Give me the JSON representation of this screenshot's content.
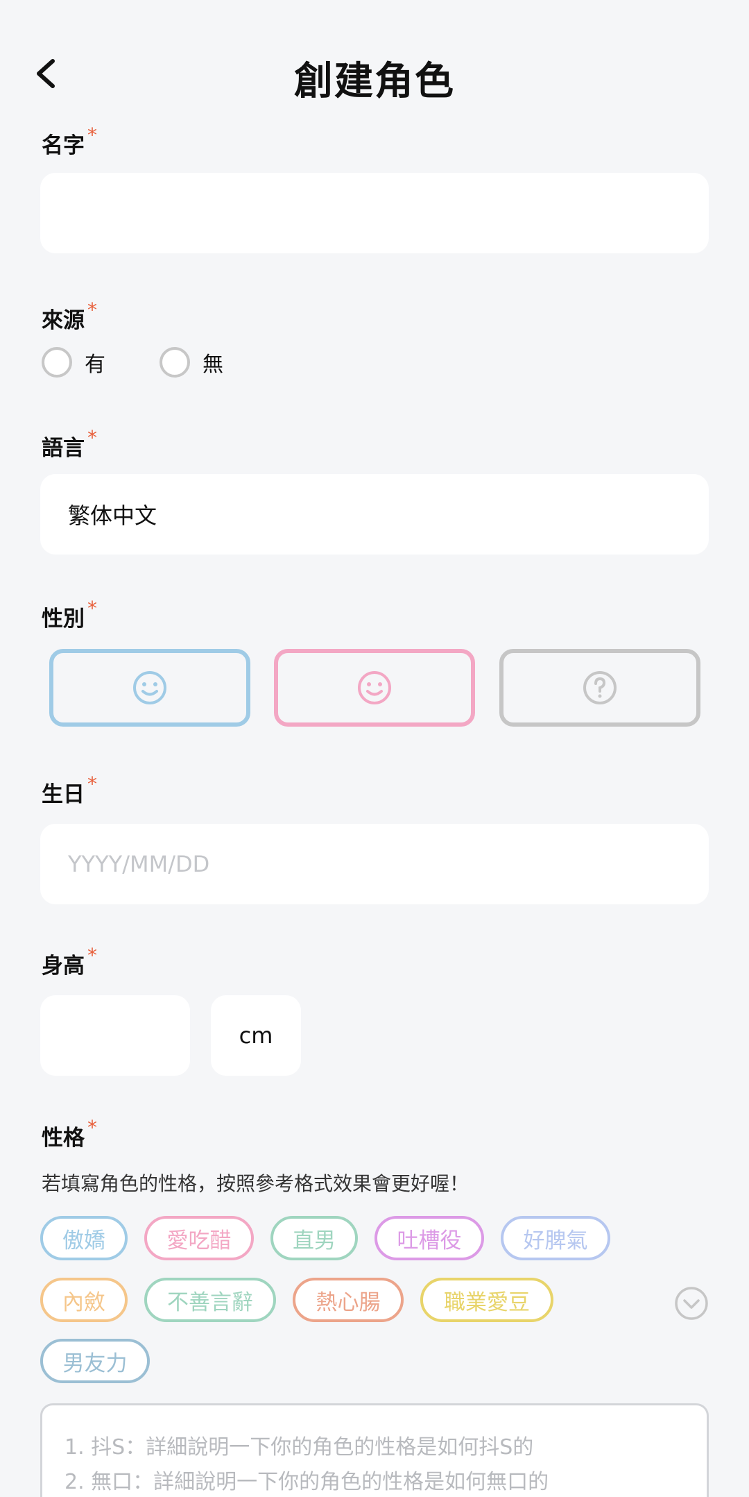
{
  "header": {
    "title": "創建角色"
  },
  "name": {
    "label": "名字",
    "required": "*",
    "value": ""
  },
  "source": {
    "label": "來源",
    "required": "*",
    "options": [
      "有",
      "無"
    ]
  },
  "language": {
    "label": "語言",
    "required": "*",
    "value": "繁体中文"
  },
  "gender": {
    "label": "性別",
    "required": "*",
    "options": [
      {
        "icon": "smiley-icon",
        "color": "#9fcbe6"
      },
      {
        "icon": "smiley-icon",
        "color": "#f3a7c4"
      },
      {
        "icon": "question-icon",
        "color": "#c6c6c6"
      }
    ]
  },
  "birthday": {
    "label": "生日",
    "required": "*",
    "placeholder": "YYYY/MM/DD"
  },
  "height": {
    "label": "身高",
    "required": "*",
    "value": "",
    "unit": "cm"
  },
  "personality": {
    "label": "性格",
    "required": "*",
    "hint": "若填寫角色的性格，按照參考格式效果會更好喔！",
    "tags": [
      {
        "label": "傲嬌",
        "color": "#9fcbe6"
      },
      {
        "label": "愛吃醋",
        "color": "#f3a7c4"
      },
      {
        "label": "直男",
        "color": "#9fd5bf"
      },
      {
        "label": "吐槽役",
        "color": "#dc9ae6"
      },
      {
        "label": "好脾氣",
        "color": "#b6c7f0"
      },
      {
        "label": "內斂",
        "color": "#f5c68a"
      },
      {
        "label": "不善言辭",
        "color": "#9fd5bf"
      },
      {
        "label": "熱心腸",
        "color": "#eca48a"
      },
      {
        "label": "職業愛豆",
        "color": "#e8d46a"
      },
      {
        "label": "男友力",
        "color": "#9bbfd4"
      }
    ],
    "placeholder_lines": [
      "1. 抖S：詳細說明一下你的角色的性格是如何抖S的",
      "2. 無口：詳細說明一下你的角色的性格是如何無口的"
    ]
  }
}
